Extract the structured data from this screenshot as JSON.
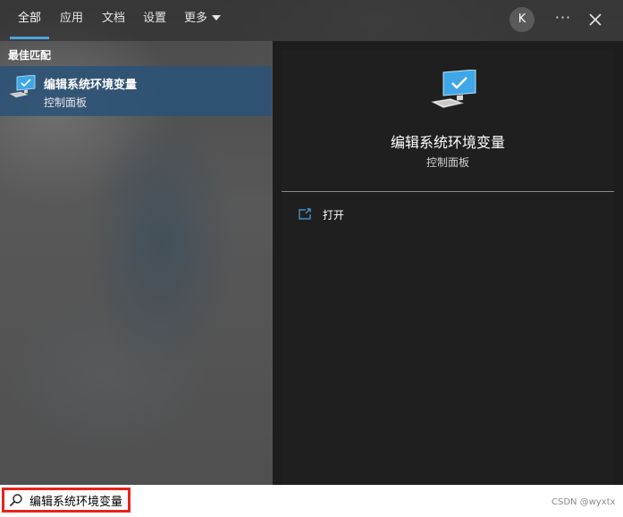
{
  "tabs": [
    {
      "label": "全部",
      "active": true
    },
    {
      "label": "应用",
      "active": false
    },
    {
      "label": "文档",
      "active": false
    },
    {
      "label": "设置",
      "active": false
    },
    {
      "label": "更多",
      "active": false
    }
  ],
  "topbar": {
    "avatar_initial": "K",
    "more_options_glyph": "···",
    "close_icon": "close-icon"
  },
  "results": {
    "section_title": "最佳匹配",
    "best_match": {
      "title": "编辑系统环境变量",
      "subtitle": "控制面板",
      "icon": "computer-monitor-icon"
    }
  },
  "preview": {
    "title": "编辑系统环境变量",
    "subtitle": "控制面板",
    "icon": "computer-monitor-icon",
    "actions": [
      {
        "label": "打开",
        "icon": "open-window-icon"
      }
    ]
  },
  "search": {
    "value": "编辑系统环境变量",
    "icon": "search-icon"
  },
  "watermark": "CSDN @wyxtx",
  "colors": {
    "accent": "#4aa3df",
    "selected_row": "#2a5278",
    "highlight_border": "#e8231d",
    "preview_bg": "#1f1f1f"
  }
}
